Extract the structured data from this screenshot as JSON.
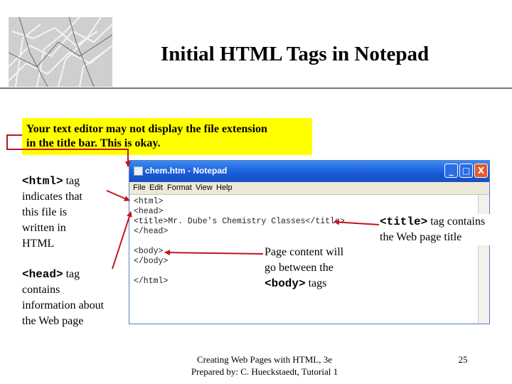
{
  "slide": {
    "title": "Initial HTML Tags in Notepad",
    "callout_line1": "Your text editor may not display the file extension",
    "callout_line2": "in the title bar.  This is okay."
  },
  "annotations": {
    "html_tag": "<html>",
    "html_rest": " tag",
    "html_lines": [
      "indicates that",
      "this file is",
      "written in",
      "HTML"
    ],
    "head_tag": "<head>",
    "head_rest": " tag",
    "head_lines": [
      "contains",
      "information about",
      "the Web page"
    ],
    "body_lines": [
      "Page content will",
      "go between the"
    ],
    "body_tag": "<body>",
    "body_rest": " tags",
    "title_tag": "<title>",
    "title_rest": " tag contains",
    "title_line2": "the Web page title"
  },
  "notepad": {
    "window_title": "chem.htm - Notepad",
    "menu": [
      "File",
      "Edit",
      "Format",
      "View",
      "Help"
    ],
    "lines": [
      "<html>",
      "<head>",
      "<title>Mr. Dube's Chemistry Classes</title>",
      "</head>",
      "",
      "<body>",
      "</body>",
      "",
      "</html>"
    ],
    "buttons": {
      "minimize": "_",
      "maximize": "□",
      "close": "X"
    }
  },
  "footer": {
    "line1": "Creating Web Pages with HTML, 3e",
    "line2": "Prepared by: C. Hueckstaedt, Tutorial 1",
    "page_number": "25"
  },
  "colors": {
    "callout": "#ffff00",
    "arrow": "#c0141c",
    "titlebar": "#1859d8"
  }
}
